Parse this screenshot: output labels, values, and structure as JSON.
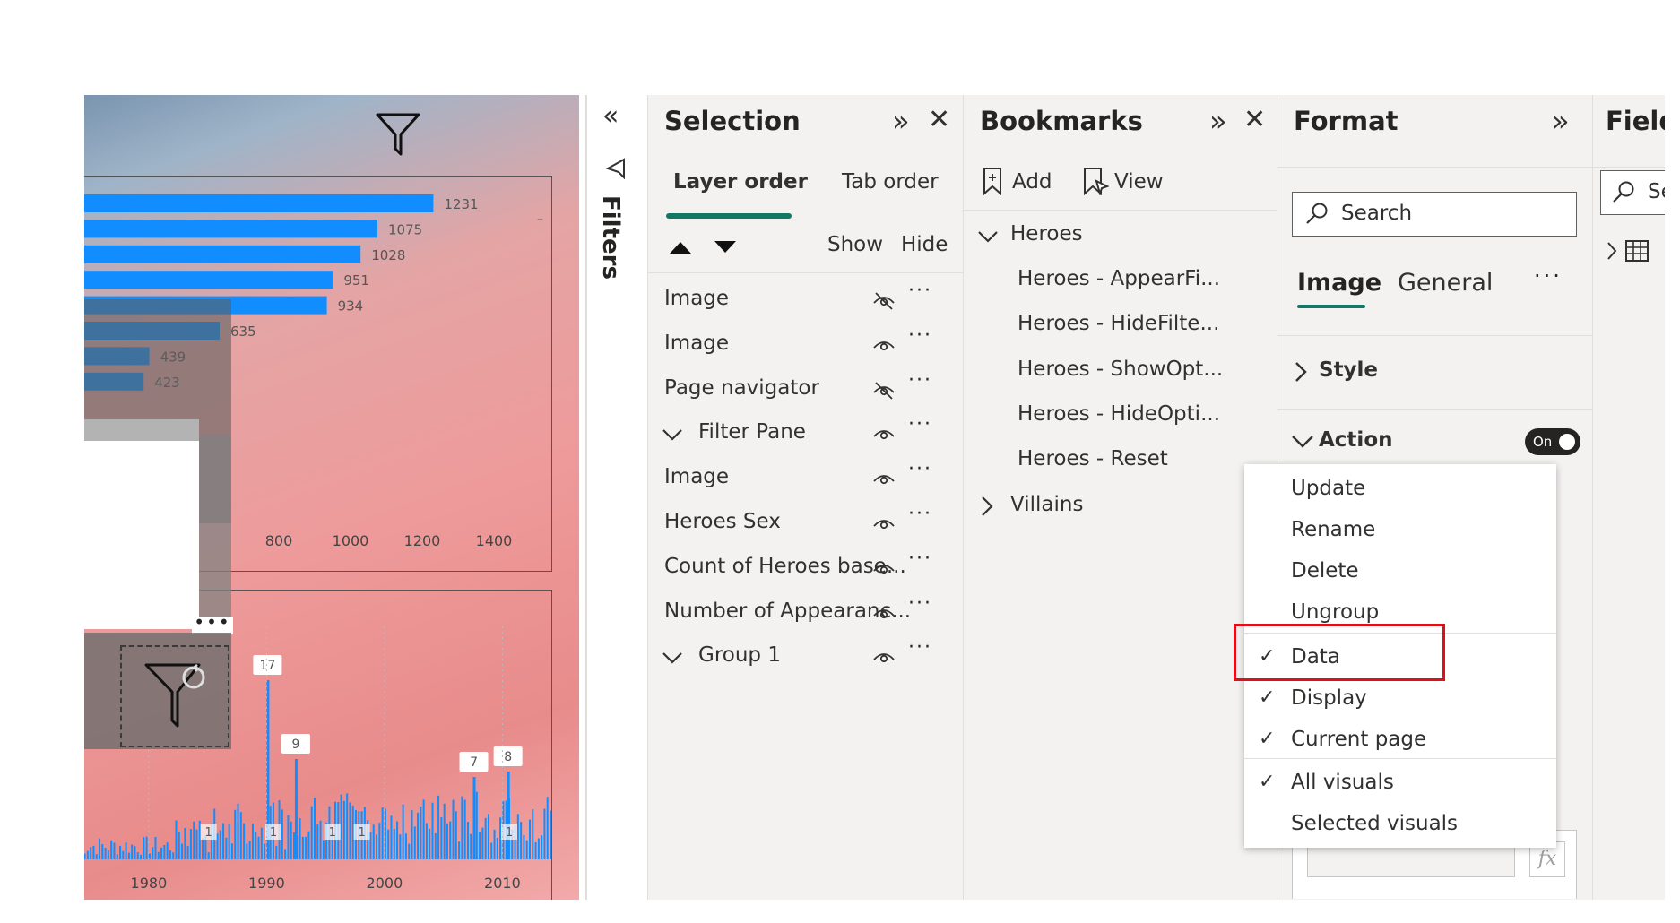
{
  "canvas": {
    "bar_chart": {
      "labels": [
        "1231",
        "1075",
        "1028",
        "951",
        "934",
        "635",
        "439",
        "423"
      ],
      "values": [
        1231,
        1075,
        1028,
        951,
        934,
        635,
        439,
        423
      ],
      "x_ticks": [
        "800",
        "1000",
        "1200",
        "1400"
      ],
      "x_min": 0,
      "x_max": 1400
    },
    "column_chart": {
      "peak_labels": [
        "17",
        "9",
        "7",
        "8"
      ],
      "ones_labels": [
        "1",
        "1",
        "1",
        "1",
        "1"
      ],
      "x_ticks": [
        "1980",
        "1990",
        "2000",
        "2010"
      ],
      "more_icon": "ellipsis-icon"
    }
  },
  "filters_strip": {
    "collapse_icon": "double-chevron-left-icon",
    "label": "Filters"
  },
  "selection": {
    "title": "Selection",
    "tabs": [
      "Layer order",
      "Tab order"
    ],
    "show_label": "Show",
    "hide_label": "Hide",
    "layers": [
      {
        "label": "Image",
        "visible": false,
        "expander": false
      },
      {
        "label": "Image",
        "visible": true,
        "expander": false
      },
      {
        "label": "Page navigator",
        "visible": false,
        "expander": false
      },
      {
        "label": "Filter Pane",
        "visible": true,
        "expander": true
      },
      {
        "label": "Image",
        "visible": true,
        "expander": false
      },
      {
        "label": "Heroes Sex",
        "visible": true,
        "expander": false
      },
      {
        "label": "Count of Heroes base...",
        "visible": true,
        "expander": false
      },
      {
        "label": "Number of Appearanc...",
        "visible": true,
        "expander": false
      },
      {
        "label": "Group 1",
        "visible": true,
        "expander": true
      }
    ]
  },
  "bookmarks": {
    "title": "Bookmarks",
    "add_label": "Add",
    "view_label": "View",
    "groups": [
      {
        "label": "Heroes",
        "expanded": true,
        "items": [
          "Heroes - AppearFi...",
          "Heroes - HideFilte...",
          "Heroes - ShowOpt...",
          "Heroes - HideOpti...",
          "Heroes - Reset"
        ]
      },
      {
        "label": "Villains",
        "expanded": false,
        "items": []
      }
    ]
  },
  "format": {
    "title": "Format",
    "search_placeholder": "Search",
    "tabs": [
      "Image",
      "General"
    ],
    "style_label": "Style",
    "action_label": "Action",
    "toggle_label": "On"
  },
  "fields": {
    "title": "Field",
    "search_placeholder": "Se"
  },
  "menu": {
    "items": [
      {
        "label": "Update",
        "checked": false
      },
      {
        "label": "Rename",
        "checked": false
      },
      {
        "label": "Delete",
        "checked": false
      },
      {
        "label": "Ungroup",
        "checked": false
      },
      {
        "label": "Data",
        "checked": true,
        "highlighted": true
      },
      {
        "label": "Display",
        "checked": true
      },
      {
        "label": "Current page",
        "checked": true
      },
      {
        "label": "All visuals",
        "checked": true
      },
      {
        "label": "Selected visuals",
        "checked": false
      }
    ]
  },
  "colors": {
    "accent": "#117865",
    "bar": "#118dff",
    "highlight_box": "#e0101a"
  },
  "fx_label": "fx"
}
